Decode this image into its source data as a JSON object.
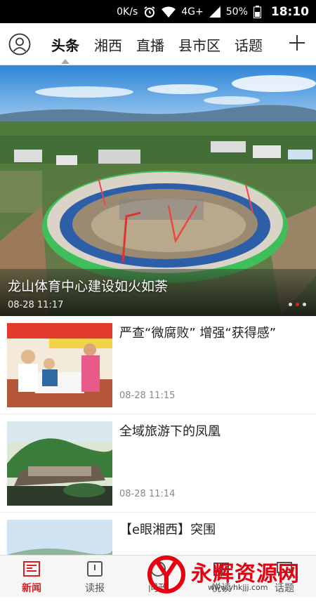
{
  "status_bar": {
    "speed": "0K/s",
    "network": "4G+",
    "battery": "50%",
    "time": "18:10",
    "icons": [
      "alarm-icon",
      "wifi-icon",
      "signal-icon",
      "battery-icon"
    ]
  },
  "nav": {
    "tabs": [
      {
        "label": "头条",
        "active": true
      },
      {
        "label": "湘西",
        "active": false
      },
      {
        "label": "直播",
        "active": false
      },
      {
        "label": "县市区",
        "active": false
      },
      {
        "label": "话题",
        "active": false
      }
    ],
    "avatar_icon": "user-avatar-icon",
    "add_icon": "plus-icon"
  },
  "hero": {
    "title": "龙山体育中心建设如火如荼",
    "time": "08-28 11:17",
    "dot_count": 3,
    "active_dot": 0
  },
  "news": [
    {
      "title": "严查“微腐败” 增强“获得感”",
      "time": "08-28 11:15"
    },
    {
      "title": "全域旅游下的凤凰",
      "time": "08-28 11:14"
    },
    {
      "title": "【e眼湘西】突围",
      "time": ""
    }
  ],
  "bottom_tabs": [
    {
      "label": "新闻",
      "icon": "newspaper-icon",
      "active": true
    },
    {
      "label": "读报",
      "icon": "paper-reader-icon",
      "active": false
    },
    {
      "label": "问政",
      "icon": "question-icon",
      "active": false
    },
    {
      "label": "悦读",
      "icon": "book-icon",
      "active": false
    },
    {
      "label": "话题",
      "icon": "topic-icon",
      "active": false
    }
  ],
  "watermark": {
    "text": "永辉资源网",
    "url": "www.yhkjjj.com"
  },
  "colors": {
    "accent": "#d92020",
    "status_bar": "#000000"
  }
}
